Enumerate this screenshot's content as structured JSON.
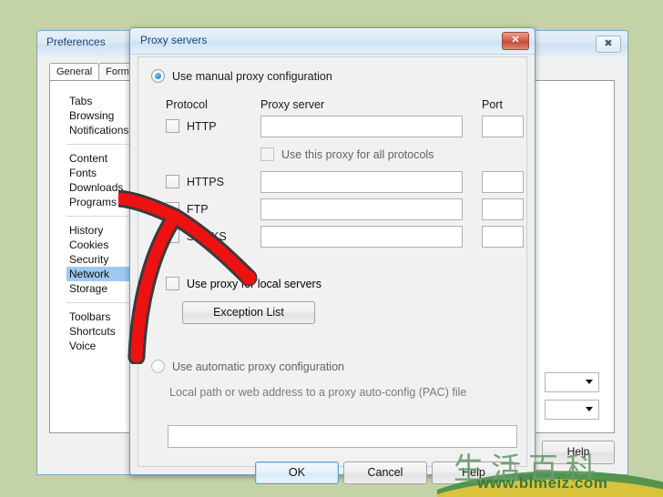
{
  "desktop": {
    "background_color": "#c3d3a6"
  },
  "prefs_window": {
    "title": "Preferences",
    "close_icon": "close-icon",
    "tabs": [
      {
        "label": "General",
        "active": true
      },
      {
        "label": "Forms",
        "active": false
      }
    ],
    "sidebar_groups": [
      {
        "items": [
          {
            "label": "Tabs",
            "selected": false
          },
          {
            "label": "Browsing",
            "selected": false
          },
          {
            "label": "Notifications",
            "selected": false
          }
        ]
      },
      {
        "items": [
          {
            "label": "Content",
            "selected": false
          },
          {
            "label": "Fonts",
            "selected": false
          },
          {
            "label": "Downloads",
            "selected": false
          },
          {
            "label": "Programs",
            "selected": false
          }
        ]
      },
      {
        "items": [
          {
            "label": "History",
            "selected": false
          },
          {
            "label": "Cookies",
            "selected": false
          },
          {
            "label": "Security",
            "selected": false
          },
          {
            "label": "Network",
            "selected": true
          },
          {
            "label": "Storage",
            "selected": false
          }
        ]
      },
      {
        "items": [
          {
            "label": "Toolbars",
            "selected": false
          },
          {
            "label": "Shortcuts",
            "selected": false
          },
          {
            "label": "Voice",
            "selected": false
          }
        ]
      }
    ],
    "dropdowns": [
      {
        "value": "",
        "icon": "chevron-down-icon"
      },
      {
        "value": "",
        "icon": "chevron-down-icon"
      }
    ],
    "help_label": "Help",
    "selected_highlight_color": "#9ec9ef"
  },
  "dialog": {
    "title": "Proxy servers",
    "close_icon": "close-icon",
    "close_glyph": "✕",
    "close_color": "#c14a32",
    "manual_radio": {
      "label": "Use manual proxy configuration",
      "checked": true
    },
    "columns": {
      "protocol": "Protocol",
      "proxy_server": "Proxy server",
      "port": "Port"
    },
    "protocols": [
      {
        "name": "HTTP",
        "checked": false,
        "server": "",
        "port": ""
      },
      {
        "name": "HTTPS",
        "checked": false,
        "server": "",
        "port": ""
      },
      {
        "name": "FTP",
        "checked": false,
        "server": "",
        "port": ""
      },
      {
        "name": "SOCKS",
        "checked": false,
        "server": "",
        "port": ""
      }
    ],
    "all_protocols_checkbox": {
      "label": "Use this proxy for all protocols",
      "checked": false,
      "enabled": false
    },
    "local_servers_checkbox": {
      "label": "Use proxy for local servers",
      "checked": false
    },
    "exception_list_button": "Exception List",
    "auto_radio": {
      "label": "Use automatic proxy configuration",
      "checked": false
    },
    "auto_hint": "Local path or web address to a proxy auto-config (PAC) file",
    "auto_field_value": "",
    "buttons": {
      "ok": "OK",
      "cancel": "Cancel",
      "help": "Help"
    }
  },
  "annotation": {
    "arrow_color": "#ee1111",
    "arrow_outline_color": "#3a3a3a",
    "points_to": "HTTP"
  },
  "watermark": {
    "cjk_text": "生活百科",
    "url": "www.bimeiz.com",
    "color": "#3b7a3b"
  }
}
